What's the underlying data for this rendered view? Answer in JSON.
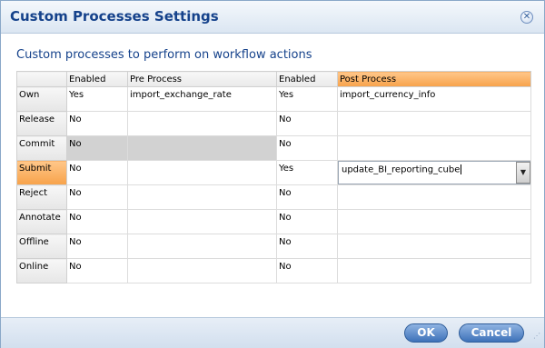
{
  "dialog": {
    "title": "Custom Processes Settings",
    "subtitle": "Custom processes to perform on workflow actions"
  },
  "table": {
    "headers": {
      "row_header": "",
      "enabled_pre": "Enabled",
      "pre_process": "Pre Process",
      "enabled_post": "Enabled",
      "post_process": "Post Process"
    },
    "rows": [
      {
        "action": "Own",
        "pre_enabled": "Yes",
        "pre_process": "import_exchange_rate",
        "post_enabled": "Yes",
        "post_process": "import_currency_info"
      },
      {
        "action": "Release",
        "pre_enabled": "No",
        "pre_process": "",
        "post_enabled": "No",
        "post_process": ""
      },
      {
        "action": "Commit",
        "pre_enabled": "No",
        "pre_process": "",
        "post_enabled": "No",
        "post_process": ""
      },
      {
        "action": "Submit",
        "pre_enabled": "No",
        "pre_process": "",
        "post_enabled": "Yes",
        "post_process": "update_BI_reporting_cube"
      },
      {
        "action": "Reject",
        "pre_enabled": "No",
        "pre_process": "",
        "post_enabled": "No",
        "post_process": ""
      },
      {
        "action": "Annotate",
        "pre_enabled": "No",
        "pre_process": "",
        "post_enabled": "No",
        "post_process": ""
      },
      {
        "action": "Offline",
        "pre_enabled": "No",
        "pre_process": "",
        "post_enabled": "No",
        "post_process": ""
      },
      {
        "action": "Online",
        "pre_enabled": "No",
        "pre_process": "",
        "post_enabled": "No",
        "post_process": ""
      }
    ]
  },
  "buttons": {
    "ok": "OK",
    "cancel": "Cancel"
  },
  "colors": {
    "title": "#15428b",
    "highlight": "#f7a24a",
    "disabled_cell": "#d2d2d2"
  },
  "icons": {
    "close": "close-icon",
    "dropdown": "chevron-down-icon",
    "resize": "resize-grip-icon"
  }
}
